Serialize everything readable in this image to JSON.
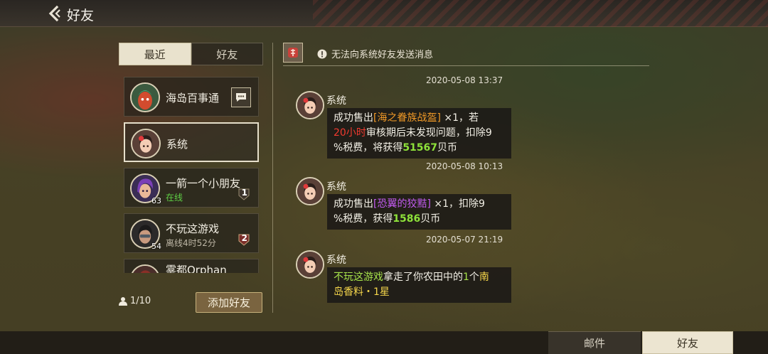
{
  "header": {
    "title": "好友"
  },
  "tabs": [
    {
      "label": "最近",
      "active": true
    },
    {
      "label": "好友",
      "active": false
    }
  ],
  "friends": [
    {
      "name": "海岛百事通",
      "status": "",
      "level": "",
      "badge": ""
    },
    {
      "name": "系统",
      "status": "",
      "level": "",
      "badge": ""
    },
    {
      "name": "一箭一个小朋友",
      "status": "在线",
      "level": "63",
      "badge": "1"
    },
    {
      "name": "不玩这游戏",
      "status": "离线4时52分",
      "level": "54",
      "badge": "2"
    },
    {
      "name": "雾都Orphan",
      "status": "",
      "level": "",
      "badge": ""
    }
  ],
  "footer": {
    "friend_count": "1/10",
    "add_friend_label": "添加好友"
  },
  "chat": {
    "notice": "无法向系统好友发送消息",
    "messages": [
      {
        "timestamp": "2020-05-08  13:37",
        "sender": "系统",
        "parts": [
          "成功售出",
          "[海之眷族战盔]",
          " ×1，若",
          "20小时",
          "审核期后未发现问题，扣除9",
          "%税费，将获得",
          "51567",
          "贝币"
        ]
      },
      {
        "timestamp": "2020-05-08  10:13",
        "sender": "系统",
        "parts": [
          "成功售出",
          "[恐翼的狡黠]",
          " ×1，扣除9",
          "%税费，获得",
          "1586",
          "贝币"
        ]
      },
      {
        "timestamp": "2020-05-07  21:19",
        "sender": "系统",
        "parts": [
          "不玩这游戏",
          "拿走了你农田中的",
          "1",
          "个",
          "南",
          "岛香料・1星"
        ]
      }
    ]
  },
  "bottom_tabs": {
    "mail": "邮件",
    "friends": "好友"
  },
  "colors": {
    "online": "#5fd045",
    "item_orange": "#f29a27",
    "item_purple": "#c25bf0",
    "highlight_green": "#8ee23a",
    "warn_red": "#f23a2f"
  }
}
